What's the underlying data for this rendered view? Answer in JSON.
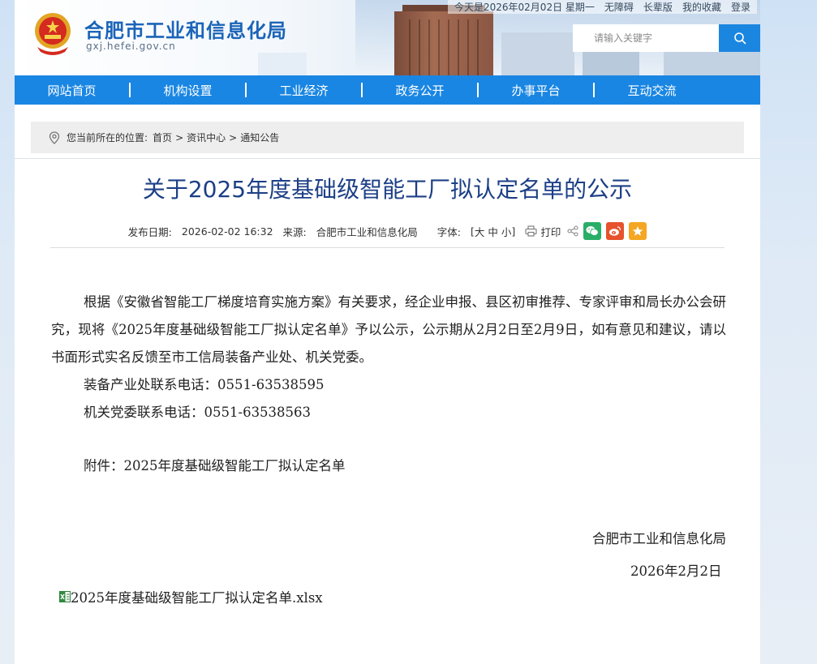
{
  "site": {
    "title": "合肥市工业和信息化局",
    "url": "gxj.hefei.gov.cn"
  },
  "topbar": {
    "date": "今天是2026年02月02日 星期一",
    "accessible": "无障碍",
    "elder": "长辈版",
    "favorites": "我的收藏",
    "login": "登录"
  },
  "search": {
    "placeholder": "请输入关键字"
  },
  "nav": {
    "items": [
      "网站首页",
      "机构设置",
      "工业经济",
      "政务公开",
      "办事平台",
      "互动交流"
    ]
  },
  "breadcrumb": {
    "prefix": "您当前所在的位置:",
    "items": [
      "首页",
      "资讯中心",
      "通知公告"
    ],
    "separator": ">"
  },
  "article": {
    "title": "关于2025年度基础级智能工厂拟认定名单的公示",
    "meta": {
      "date_label": "发布日期:",
      "date": "2026-02-02 16:32",
      "source_label": "来源:",
      "source": "合肥市工业和信息化局",
      "font_label": "字体:",
      "font_open": "[",
      "font_large": "大",
      "font_medium": "中",
      "font_small": "小",
      "font_close": "]",
      "print": "打印"
    },
    "paragraphs": [
      "根据《安徽省智能工厂梯度培育实施方案》有关要求，经企业申报、县区初审推荐、专家评审和局长办公会研究，现将《2025年度基础级智能工厂拟认定名单》予以公示，公示期从2月2日至2月9日，如有意见和建议，请以书面形式实名反馈至市工信局装备产业处、机关党委。",
      "装备产业处联系电话：0551-63538595",
      "机关党委联系电话：0551-63538563",
      "附件：2025年度基础级智能工厂拟认定名单"
    ],
    "signature": "合肥市工业和信息化局",
    "sign_date": "2026年2月2日",
    "attachment": "2025年度基础级智能工厂拟认定名单.xlsx"
  },
  "colors": {
    "nav": "#1a86e3",
    "title": "#1c3f86",
    "site_title": "#1b64b8",
    "wechat": "#2aae67",
    "weibo": "#e6522c",
    "favorite": "#f5a623"
  }
}
